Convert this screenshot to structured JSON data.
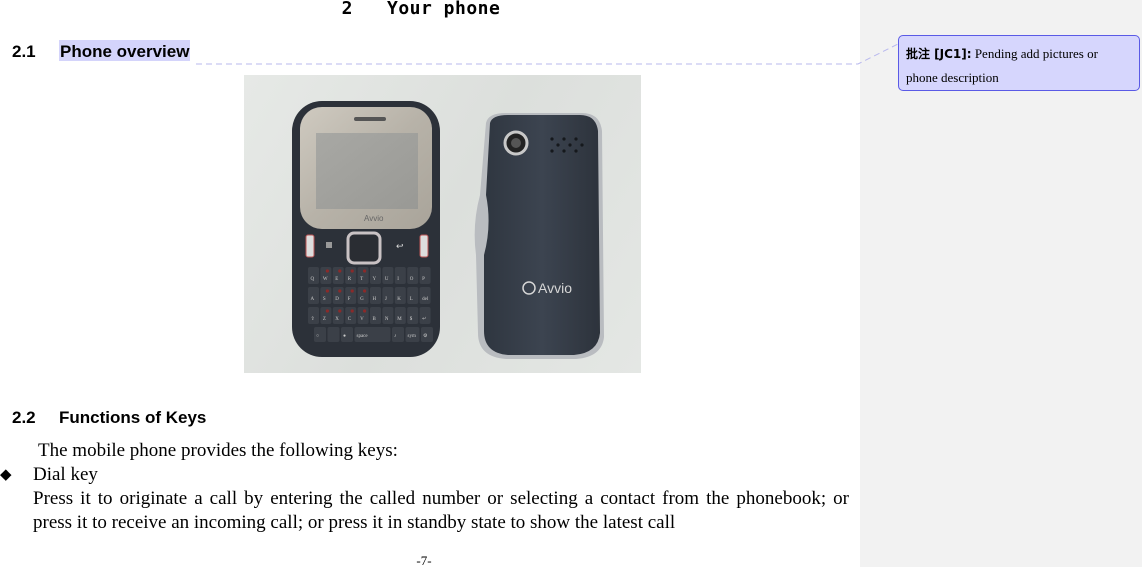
{
  "document": {
    "chapter_title": "2   Your phone",
    "sections": [
      {
        "number": "2.1",
        "title": "Phone overview"
      },
      {
        "number": "2.2",
        "title": "Functions of Keys"
      }
    ],
    "intro_text": "The mobile phone provides the following keys:",
    "bullets": [
      {
        "icon": "diamond-bullet-icon",
        "glyph": "◆",
        "label": "Dial key",
        "description": "Press it to originate a call by entering the called number or selecting a contact from the phonebook; or press it to receive an incoming call; or press it in standby state to show the latest call"
      }
    ],
    "page_number": "-7-"
  },
  "photo": {
    "description": "Front and back of Avvio QWERTY mobile phone",
    "brand_text": "Avvio",
    "keyboard": {
      "row1": [
        "Q",
        "W",
        "E",
        "R",
        "T",
        "Y",
        "U",
        "I",
        "O",
        "P"
      ],
      "row2": [
        "A",
        "S",
        "D",
        "F",
        "G",
        "H",
        "J",
        "K",
        "L",
        "del"
      ],
      "row3": [
        "⇧",
        "Z",
        "X",
        "C",
        "V",
        "B",
        "N",
        "M",
        "$",
        "↵"
      ],
      "row4": [
        "○",
        "",
        "●",
        "space",
        "♪",
        "sym",
        "⚙"
      ]
    }
  },
  "comment": {
    "author_label": "批注 [JC1]:",
    "text": "Pending add pictures or phone description",
    "highlight_color": "#d4d4fb",
    "border_color": "#5a5ae6"
  }
}
